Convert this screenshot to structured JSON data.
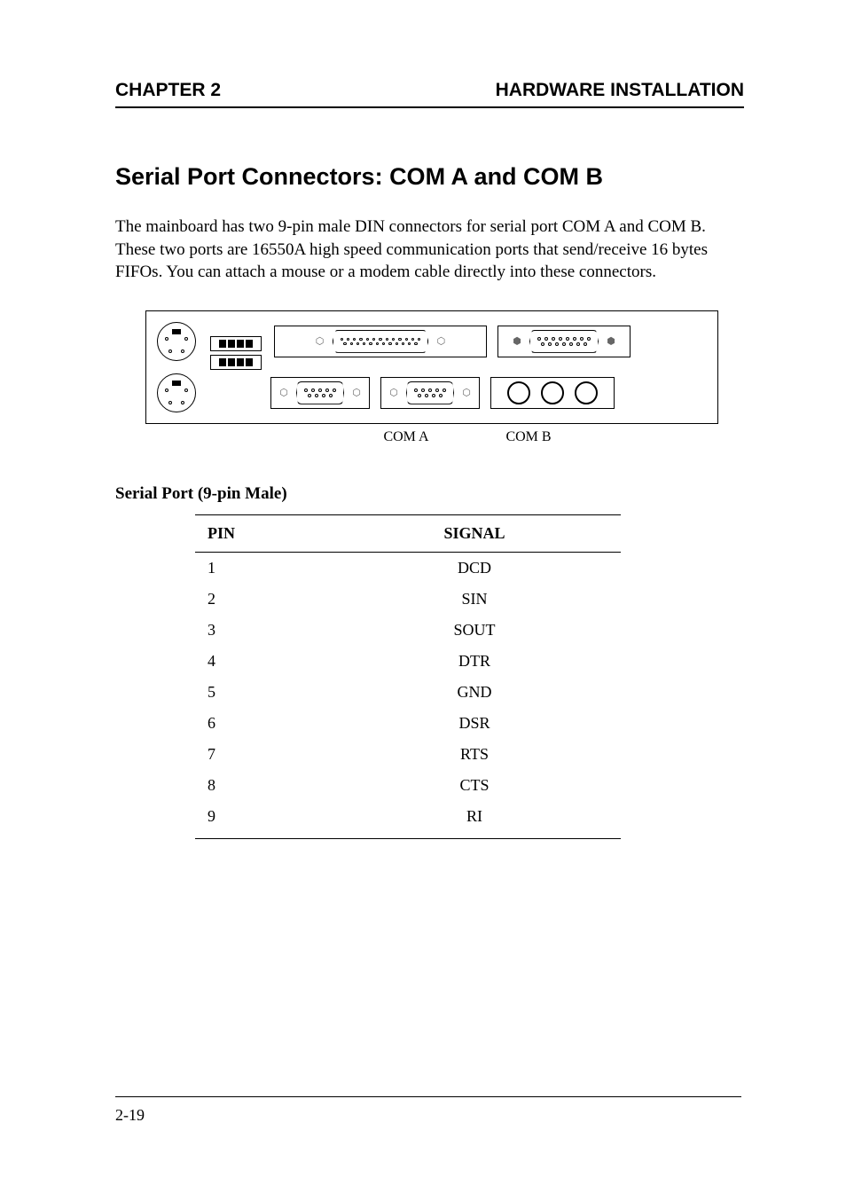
{
  "header": {
    "chapter": "CHAPTER 2",
    "title": "HARDWARE INSTALLATION"
  },
  "section_title": "Serial Port Connectors:  COM A and COM B",
  "intro_text": "The mainboard has two 9-pin male DIN connectors for serial port COM A and COM B.  These two ports are 16550A high speed communication ports that send/receive 16 bytes FIFOs.  You can attach a mouse or a modem cable directly into these connectors.",
  "labels": {
    "com_a": "COM A",
    "com_b": "COM B"
  },
  "pins_heading": "Serial Port (9-pin Male)",
  "pins_table": {
    "headers": {
      "pin": "PIN",
      "signal": "SIGNAL"
    },
    "rows": [
      {
        "pin": "1",
        "signal": "DCD"
      },
      {
        "pin": "2",
        "signal": "SIN"
      },
      {
        "pin": "3",
        "signal": "SOUT"
      },
      {
        "pin": "4",
        "signal": "DTR"
      },
      {
        "pin": "5",
        "signal": "GND"
      },
      {
        "pin": "6",
        "signal": "DSR"
      },
      {
        "pin": "7",
        "signal": "RTS"
      },
      {
        "pin": "8",
        "signal": "CTS"
      },
      {
        "pin": "9",
        "signal": "RI"
      }
    ]
  },
  "footer": {
    "page_number": "2-19"
  }
}
